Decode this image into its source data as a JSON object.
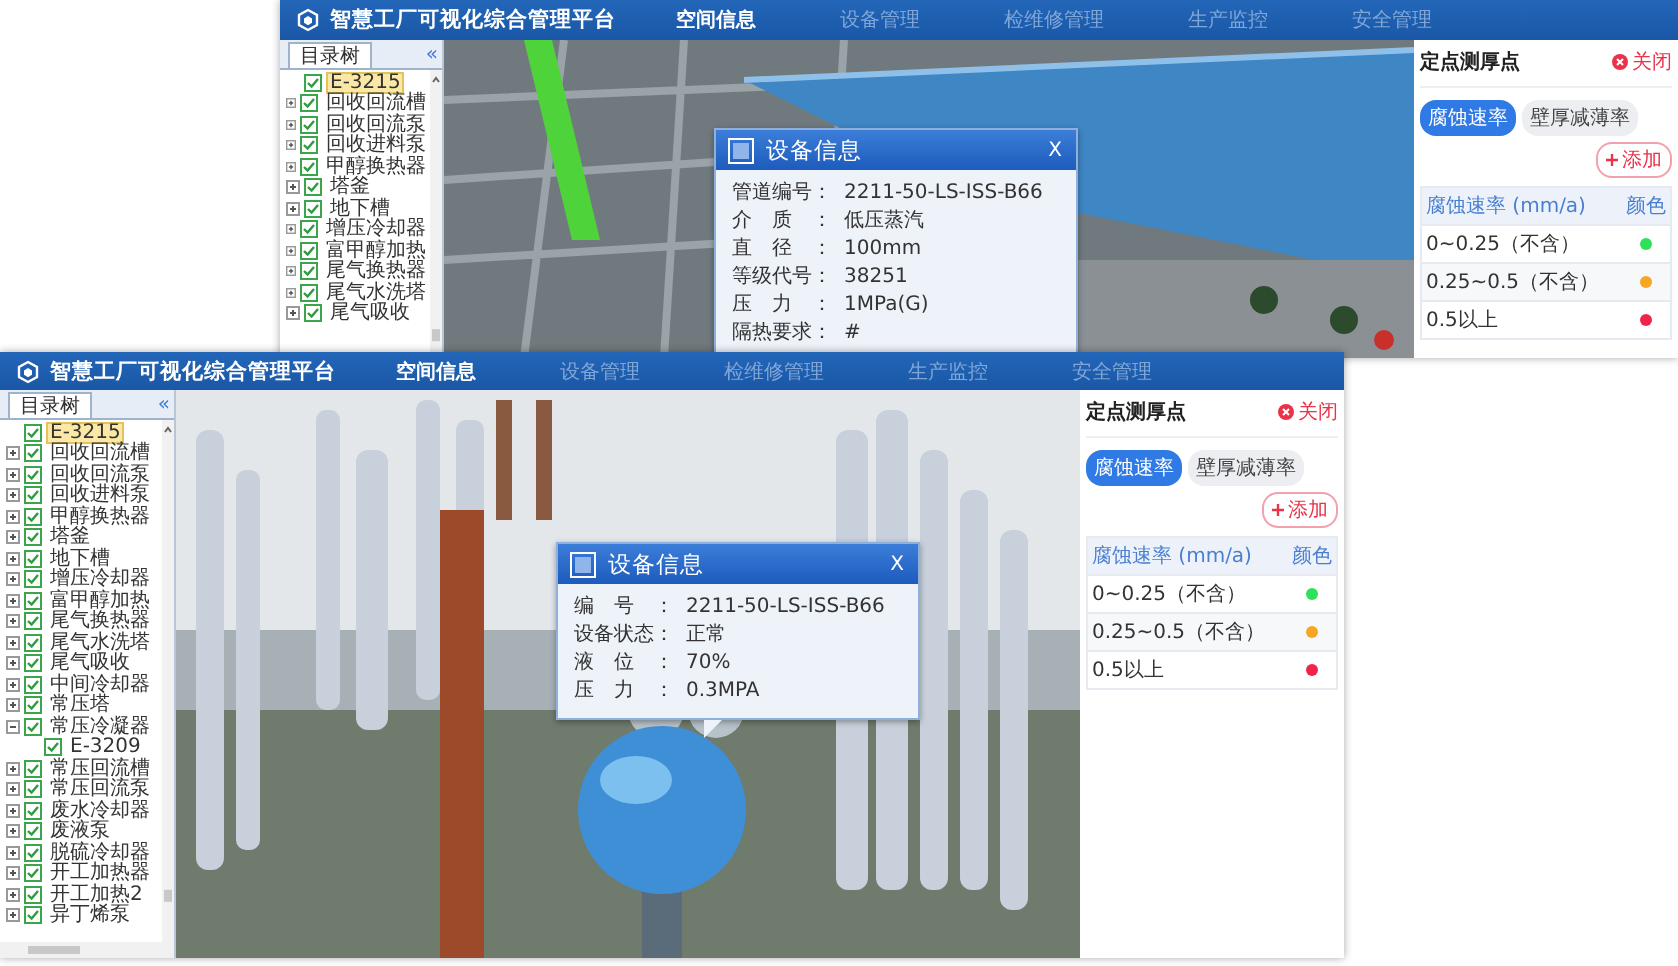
{
  "windows": [
    {
      "header": {
        "title": "智慧工厂可视化综合管理平台",
        "nav": [
          {
            "label": "空间信息",
            "selected": true
          },
          {
            "label": "设备管理",
            "selected": false
          },
          {
            "label": "检维修管理",
            "selected": false
          },
          {
            "label": "生产监控",
            "selected": false
          },
          {
            "label": "安全管理",
            "selected": false
          }
        ]
      },
      "tree": {
        "tab": "目录树",
        "collapse": "«",
        "items": [
          {
            "label": "E-3215",
            "checked": true,
            "selected": true
          },
          {
            "label": "回收回流槽",
            "checked": true,
            "selected": false,
            "expanded": false
          },
          {
            "label": "回收回流泵",
            "checked": true,
            "selected": false,
            "expanded": false
          },
          {
            "label": "回收进料泵",
            "checked": true,
            "selected": false,
            "expanded": false
          },
          {
            "label": "甲醇换热器",
            "checked": true,
            "selected": false,
            "expanded": false
          },
          {
            "label": "塔釜",
            "checked": true,
            "selected": false,
            "expanded": false
          },
          {
            "label": "地下槽",
            "checked": true,
            "selected": false,
            "expanded": false
          },
          {
            "label": "增压冷却器",
            "checked": true,
            "selected": false,
            "expanded": false
          },
          {
            "label": "富甲醇加热",
            "checked": true,
            "selected": false,
            "expanded": false
          },
          {
            "label": "尾气换热器",
            "checked": true,
            "selected": false,
            "expanded": false
          },
          {
            "label": "尾气水洗塔",
            "checked": true,
            "selected": false,
            "expanded": false
          },
          {
            "label": "尾气吸收",
            "checked": true,
            "selected": false,
            "expanded": false
          }
        ]
      },
      "popup": {
        "title": "设备信息",
        "close": "X",
        "fields": [
          {
            "label": "管道编号：",
            "value": "2211-50-LS-ISS-B66"
          },
          {
            "label": "介质：",
            "value": "低压蒸汽"
          },
          {
            "label": "直径：",
            "value": "100mm"
          },
          {
            "label": "等级代号：",
            "value": "38251"
          },
          {
            "label": "压力：",
            "value": "1MPa(G)"
          },
          {
            "label": "隔热要求：",
            "value": "#"
          }
        ]
      },
      "panel": {
        "title": "定点测厚点",
        "close": "关闭",
        "tabs": [
          {
            "label": "腐蚀速率",
            "selected": true
          },
          {
            "label": "壁厚减薄率",
            "selected": false
          }
        ],
        "add": "添加",
        "table": {
          "columns": [
            "腐蚀速率 (mm/a)",
            "颜色"
          ],
          "rows": [
            {
              "range": "0~0.25（不含）",
              "color": "#2ee05a"
            },
            {
              "range": "0.25~0.5（不含）",
              "color": "#f5a623"
            },
            {
              "range": "0.5以上",
              "color": "#f0244a"
            }
          ]
        }
      }
    },
    {
      "header": {
        "title": "智慧工厂可视化综合管理平台",
        "nav": [
          {
            "label": "空间信息",
            "selected": true
          },
          {
            "label": "设备管理",
            "selected": false
          },
          {
            "label": "检维修管理",
            "selected": false
          },
          {
            "label": "生产监控",
            "selected": false
          },
          {
            "label": "安全管理",
            "selected": false
          }
        ]
      },
      "tree": {
        "tab": "目录树",
        "collapse": "«",
        "items": [
          {
            "label": "E-3215",
            "checked": true,
            "selected": true
          },
          {
            "label": "回收回流槽",
            "checked": true,
            "selected": false,
            "expanded": false
          },
          {
            "label": "回收回流泵",
            "checked": true,
            "selected": false,
            "expanded": false
          },
          {
            "label": "回收进料泵",
            "checked": true,
            "selected": false,
            "expanded": false
          },
          {
            "label": "甲醇换热器",
            "checked": true,
            "selected": false,
            "expanded": false
          },
          {
            "label": "塔釜",
            "checked": true,
            "selected": false,
            "expanded": false
          },
          {
            "label": "地下槽",
            "checked": true,
            "selected": false,
            "expanded": false
          },
          {
            "label": "增压冷却器",
            "checked": true,
            "selected": false,
            "expanded": false
          },
          {
            "label": "富甲醇加热",
            "checked": true,
            "selected": false,
            "expanded": false
          },
          {
            "label": "尾气换热器",
            "checked": true,
            "selected": false,
            "expanded": false
          },
          {
            "label": "尾气水洗塔",
            "checked": true,
            "selected": false,
            "expanded": false
          },
          {
            "label": "尾气吸收",
            "checked": true,
            "selected": false,
            "expanded": false
          },
          {
            "label": "中间冷却器",
            "checked": true,
            "selected": false,
            "expanded": false
          },
          {
            "label": "常压塔",
            "checked": true,
            "selected": false,
            "expanded": false
          },
          {
            "label": "常压冷凝器",
            "checked": true,
            "selected": false,
            "expanded": true,
            "children": [
              {
                "label": "E-3209",
                "checked": true,
                "selected": false
              }
            ]
          },
          {
            "label": "常压回流槽",
            "checked": true,
            "selected": false,
            "expanded": false
          },
          {
            "label": "常压回流泵",
            "checked": true,
            "selected": false,
            "expanded": false
          },
          {
            "label": "废水冷却器",
            "checked": true,
            "selected": false,
            "expanded": false
          },
          {
            "label": "废液泵",
            "checked": true,
            "selected": false,
            "expanded": false
          },
          {
            "label": "脱硫冷却器",
            "checked": true,
            "selected": false,
            "expanded": false
          },
          {
            "label": "开工加热器",
            "checked": true,
            "selected": false,
            "expanded": false
          },
          {
            "label": "开工加热2",
            "checked": true,
            "selected": false,
            "expanded": false
          },
          {
            "label": "异丁烯泵",
            "checked": true,
            "selected": false,
            "expanded": false
          }
        ]
      },
      "popup": {
        "title": "设备信息",
        "close": "X",
        "fields": [
          {
            "label": "编号：",
            "value": "2211-50-LS-ISS-B66"
          },
          {
            "label": "设备状态：",
            "value": "正常"
          },
          {
            "label": "液位：",
            "value": "70%"
          },
          {
            "label": "压力：",
            "value": "0.3MPA"
          }
        ]
      },
      "panel": {
        "title": "定点测厚点",
        "close": "关闭",
        "tabs": [
          {
            "label": "腐蚀速率",
            "selected": true
          },
          {
            "label": "壁厚减薄率",
            "selected": false
          }
        ],
        "add": "添加",
        "table": {
          "columns": [
            "腐蚀速率 (mm/a)",
            "颜色"
          ],
          "rows": [
            {
              "range": "0~0.25（不含）",
              "color": "#2ee05a"
            },
            {
              "range": "0.25~0.5（不含）",
              "color": "#f5a623"
            },
            {
              "range": "0.5以上",
              "color": "#f0244a"
            }
          ]
        }
      }
    }
  ]
}
